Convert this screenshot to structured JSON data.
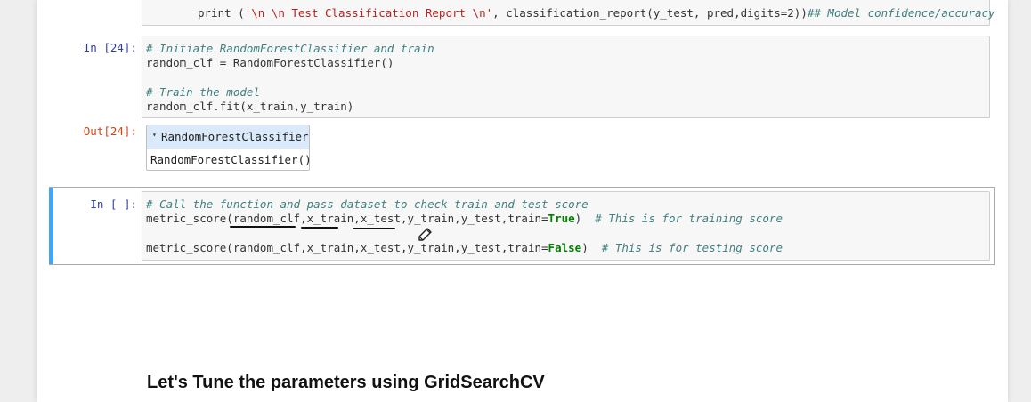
{
  "top_cell": {
    "line": {
      "prefix": "print (",
      "string": "'\\n \\n Test Classification Report \\n'",
      "rest": ", classification_report(y_test, pred,digits=2))",
      "comment": "## Model confidence/accuracy"
    }
  },
  "cell24": {
    "prompt": "In [24]:",
    "lines": [
      {
        "comment": "# Initiate RandomForestClassifier and train"
      },
      {
        "code": "random_clf = RandomForestClassifier()"
      },
      {
        "comment": "# Train the model"
      },
      {
        "code": "random_clf.fit(x_train,y_train)"
      }
    ]
  },
  "out24": {
    "prompt": "Out[24]:",
    "estimator_name": "RandomForestClassifier",
    "estimator_repr": "RandomForestClassifier()",
    "toggle_glyph": "▾"
  },
  "cell_current": {
    "prompt": "In [ ]:",
    "comment": "# Call the function and pass dataset to check train and test score",
    "line1": {
      "code": "metric_score(random_clf,x_train,x_test,y_train,y_test,train=",
      "kw": "True",
      "close": ")",
      "comment": "# This is for training score"
    },
    "line2": {
      "code": "metric_score(random_clf,x_train,x_test,y_train,y_test,train=",
      "kw": "False",
      "close": ")",
      "comment": "# This is for testing score"
    }
  },
  "markdown": {
    "heading": "Let's Tune the parameters using GridSearchCV"
  },
  "colors": {
    "selection_bar": "#42a5f5",
    "in_prompt": "#303f9f",
    "out_prompt": "#d84315",
    "comment": "#408080",
    "string": "#ba2121",
    "keyword": "#008000"
  },
  "icons": {
    "cursor": "pen-cursor-icon"
  }
}
